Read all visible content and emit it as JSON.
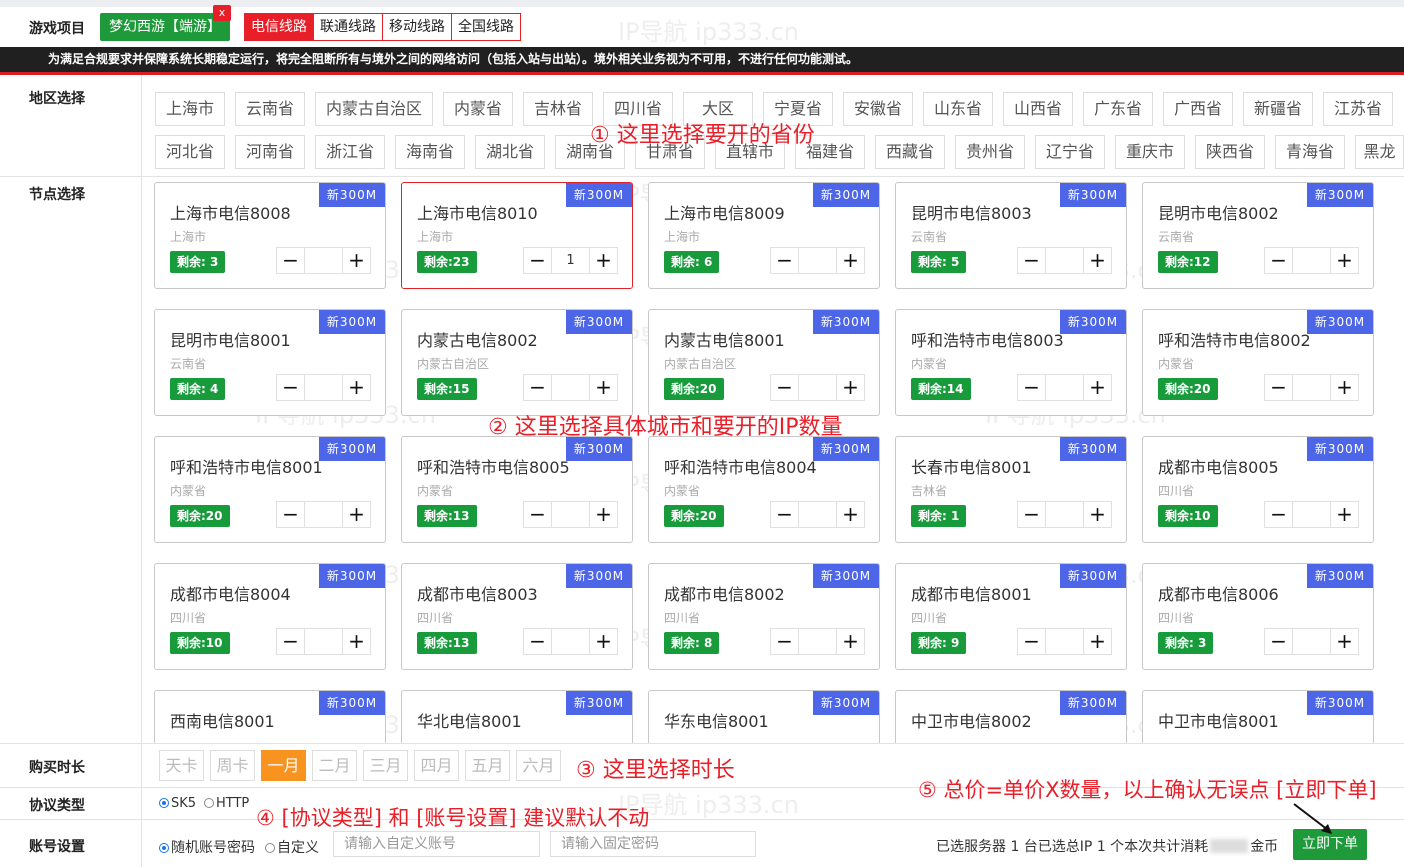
{
  "labels": {
    "game": "游戏项目",
    "region": "地区选择",
    "node": "节点选择",
    "duration": "购买时长",
    "protocol": "协议类型",
    "account": "账号设置"
  },
  "game": {
    "selected": "梦幻西游【端游】",
    "remove": "x"
  },
  "lines": [
    {
      "label": "电信线路",
      "active": true
    },
    {
      "label": "联通线路",
      "active": false
    },
    {
      "label": "移动线路",
      "active": false
    },
    {
      "label": "全国线路",
      "active": false
    }
  ],
  "banner": "为满足合规要求并保障系统长期稳定运行，将完全阻断所有与境外之间的网络访问（包括入站与出站）。境外相关业务视为不可用，不进行任何功能测试。",
  "regions_row1": [
    "上海市",
    "云南省",
    "内蒙古自治区",
    "内蒙省",
    "吉林省",
    "四川省",
    "大区",
    "宁夏省",
    "安徽省",
    "山东省",
    "山西省",
    "广东省",
    "广西省",
    "新疆省",
    "江苏省"
  ],
  "regions_row2": [
    "河北省",
    "河南省",
    "浙江省",
    "海南省",
    "湖北省",
    "湖南省",
    "甘肃省",
    "直辖市",
    "福建省",
    "西藏省",
    "贵州省",
    "辽宁省",
    "重庆市",
    "陕西省",
    "青海省",
    "黑龙"
  ],
  "node_badge": "新300M",
  "nodes": [
    {
      "name": "上海市电信8008",
      "prov": "上海市",
      "stock": "剩余: 3",
      "qty": ""
    },
    {
      "name": "上海市电信8010",
      "prov": "上海市",
      "stock": "剩余:23",
      "qty": "1",
      "selected": true
    },
    {
      "name": "上海市电信8009",
      "prov": "上海市",
      "stock": "剩余: 6",
      "qty": ""
    },
    {
      "name": "昆明市电信8003",
      "prov": "云南省",
      "stock": "剩余: 5",
      "qty": ""
    },
    {
      "name": "昆明市电信8002",
      "prov": "云南省",
      "stock": "剩余:12",
      "qty": ""
    },
    {
      "name": "昆明市电信8001",
      "prov": "云南省",
      "stock": "剩余: 4",
      "qty": ""
    },
    {
      "name": "内蒙古电信8002",
      "prov": "内蒙古自治区",
      "stock": "剩余:15",
      "qty": ""
    },
    {
      "name": "内蒙古电信8001",
      "prov": "内蒙古自治区",
      "stock": "剩余:20",
      "qty": ""
    },
    {
      "name": "呼和浩特市电信8003",
      "prov": "内蒙省",
      "stock": "剩余:14",
      "qty": ""
    },
    {
      "name": "呼和浩特市电信8002",
      "prov": "内蒙省",
      "stock": "剩余:20",
      "qty": ""
    },
    {
      "name": "呼和浩特市电信8001",
      "prov": "内蒙省",
      "stock": "剩余:20",
      "qty": ""
    },
    {
      "name": "呼和浩特市电信8005",
      "prov": "内蒙省",
      "stock": "剩余:13",
      "qty": ""
    },
    {
      "name": "呼和浩特市电信8004",
      "prov": "内蒙省",
      "stock": "剩余:20",
      "qty": ""
    },
    {
      "name": "长春市电信8001",
      "prov": "吉林省",
      "stock": "剩余: 1",
      "qty": ""
    },
    {
      "name": "成都市电信8005",
      "prov": "四川省",
      "stock": "剩余:10",
      "qty": ""
    },
    {
      "name": "成都市电信8004",
      "prov": "四川省",
      "stock": "剩余:10",
      "qty": ""
    },
    {
      "name": "成都市电信8003",
      "prov": "四川省",
      "stock": "剩余:13",
      "qty": ""
    },
    {
      "name": "成都市电信8002",
      "prov": "四川省",
      "stock": "剩余: 8",
      "qty": ""
    },
    {
      "name": "成都市电信8001",
      "prov": "四川省",
      "stock": "剩余: 9",
      "qty": ""
    },
    {
      "name": "成都市电信8006",
      "prov": "四川省",
      "stock": "剩余: 3",
      "qty": ""
    },
    {
      "name": "西南电信8001",
      "prov": "",
      "stock": "",
      "qty": ""
    },
    {
      "name": "华北电信8001",
      "prov": "",
      "stock": "",
      "qty": ""
    },
    {
      "name": "华东电信8001",
      "prov": "",
      "stock": "",
      "qty": ""
    },
    {
      "name": "中卫市电信8002",
      "prov": "",
      "stock": "",
      "qty": ""
    },
    {
      "name": "中卫市电信8001",
      "prov": "",
      "stock": "",
      "qty": ""
    }
  ],
  "stepper": {
    "minus": "−",
    "plus": "+"
  },
  "durations": [
    {
      "label": "天卡",
      "active": false
    },
    {
      "label": "周卡",
      "active": false
    },
    {
      "label": "一月",
      "active": true
    },
    {
      "label": "二月",
      "active": false
    },
    {
      "label": "三月",
      "active": false
    },
    {
      "label": "四月",
      "active": false
    },
    {
      "label": "五月",
      "active": false
    },
    {
      "label": "六月",
      "active": false
    }
  ],
  "protocol": {
    "opt1": "SK5",
    "opt2": "HTTP",
    "selected": "SK5"
  },
  "account": {
    "opt1": "随机账号密码",
    "opt2": "自定义",
    "user_placeholder": "请输入自定义账号",
    "pass_placeholder": "请输入固定密码"
  },
  "summary": {
    "before": "已选服务器 1 台已选总IP 1 个本次共计消耗",
    "after": "金币"
  },
  "order_button": "立即下单",
  "annotations": {
    "a1": "① 这里选择要开的省份",
    "a2": "② 这里选择具体城市和要开的IP数量",
    "a3": "③ 这里选择时长",
    "a4": "④ [协议类型] 和 [账号设置] 建议默认不动",
    "a5": "⑤ 总价=单价X数量，以上确认无误点 [立即下单]"
  },
  "watermark": "IP导航 ip333.cn",
  "colors": {
    "accent_red": "#e81f28",
    "green": "#1f9a3b",
    "badge_blue": "#4d66e8",
    "orange": "#f7931e"
  }
}
